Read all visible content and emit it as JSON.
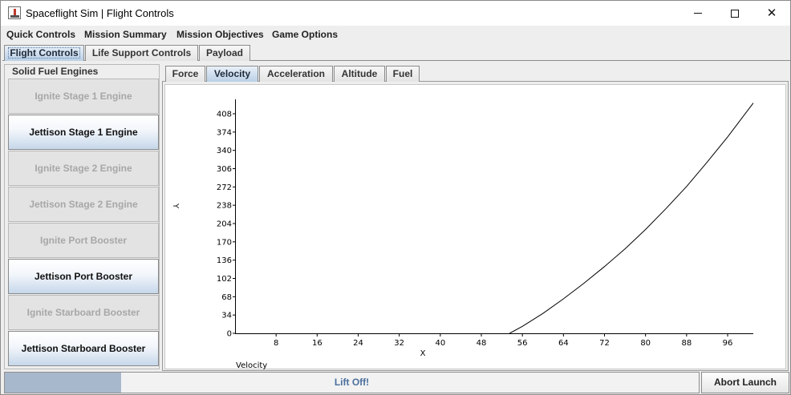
{
  "window": {
    "title": "Spaceflight Sim | Flight Controls",
    "icon": "rocket-icon"
  },
  "menu": {
    "quick_controls": "Quick Controls",
    "mission_summary": "Mission Summary",
    "mission_objectives": "Mission Objectives",
    "game_options": "Game Options"
  },
  "tabs": {
    "flight_controls": "Flight Controls",
    "life_support": "Life Support Controls",
    "payload": "Payload",
    "selected": "Flight Controls"
  },
  "engines": {
    "title": "Solid Fuel Engines",
    "buttons": [
      {
        "label": "Ignite Stage 1 Engine",
        "enabled": false
      },
      {
        "label": "Jettison Stage 1 Engine",
        "enabled": true
      },
      {
        "label": "Ignite Stage 2 Engine",
        "enabled": false
      },
      {
        "label": "Jettison Stage 2 Engine",
        "enabled": false
      },
      {
        "label": "Ignite Port Booster",
        "enabled": false
      },
      {
        "label": "Jettison Port Booster",
        "enabled": true
      },
      {
        "label": "Ignite Starboard Booster",
        "enabled": false
      },
      {
        "label": "Jettison Starboard Booster",
        "enabled": true
      }
    ]
  },
  "chart_tabs": {
    "force": "Force",
    "velocity": "Velocity",
    "acceleration": "Acceleration",
    "altitude": "Altitude",
    "fuel": "Fuel",
    "selected": "Velocity"
  },
  "chart_data": {
    "type": "line",
    "title": "Velocity",
    "xlabel": "X",
    "ylabel": "Y",
    "xlim": [
      0,
      101
    ],
    "ylim": [
      0,
      408
    ],
    "x_ticks": [
      8,
      16,
      24,
      32,
      40,
      48,
      56,
      64,
      72,
      80,
      88,
      96
    ],
    "y_ticks": [
      0,
      34,
      68,
      102,
      136,
      170,
      204,
      238,
      272,
      306,
      340,
      374,
      408
    ],
    "grid": false,
    "series": [
      {
        "line_color": "#000000",
        "x": [
          53.5,
          56,
          60,
          64,
          68,
          72,
          76,
          80,
          84,
          88,
          92,
          96,
          101
        ],
        "y": [
          0,
          13,
          37,
          64,
          93,
          124,
          157,
          193,
          232,
          273,
          318,
          365,
          428
        ]
      }
    ]
  },
  "status": {
    "progress_text": "Lift Off!",
    "progress_fraction": 0.168,
    "abort_label": "Abort Launch"
  }
}
